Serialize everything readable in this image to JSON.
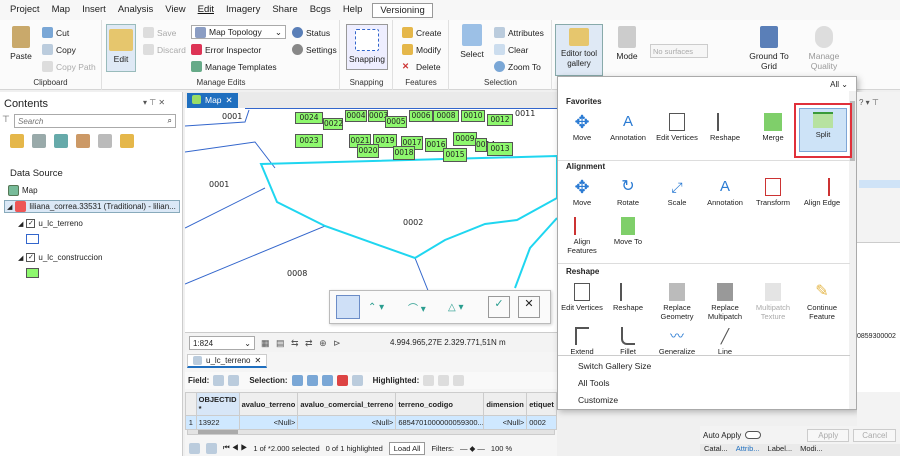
{
  "menu": [
    "Project",
    "Map",
    "Insert",
    "Analysis",
    "View",
    "Edit",
    "Imagery",
    "Share",
    "Bcgs",
    "Help",
    "Versioning"
  ],
  "ribbon": {
    "clipboard": {
      "paste": "Paste",
      "cut": "Cut",
      "copy": "Copy",
      "copy_path": "Copy Path",
      "label": "Clipboard"
    },
    "manage": {
      "edit": "Edit",
      "save": "Save",
      "discard": "Discard",
      "topology": "Map Topology",
      "error_inspector": "Error Inspector",
      "manage_templates": "Manage Templates",
      "status": "Status",
      "settings": "Settings",
      "label": "Manage Edits"
    },
    "snapping": {
      "snapping": "Snapping",
      "label": "Snapping"
    },
    "features": {
      "create": "Create",
      "modify": "Modify",
      "delete": "Delete",
      "label": "Features"
    },
    "selection": {
      "select": "Select",
      "attributes": "Attributes",
      "clear": "Clear",
      "zoom_to": "Zoom To",
      "label": "Selection"
    },
    "tools": {
      "gallery": "Editor tool gallery",
      "mode": "Mode",
      "no_surfaces": "No surfaces",
      "ground": "Ground To Grid",
      "quality": "Manage Quality"
    }
  },
  "contents": {
    "title": "Contents",
    "search_placeholder": "Search",
    "data_source": "Data Source",
    "map": "Map",
    "layer_main": "liliana_correa.33531 (Traditional) - lilian...",
    "layer1": "u_lc_terreno",
    "layer2": "u_lc_construccion"
  },
  "map": {
    "tab": "Map",
    "scale": "1:824",
    "coords": "4.994.965,27E 2.329.771,51N m",
    "labels_top": [
      "0024",
      "0022",
      "0004",
      "0003",
      "0005",
      "0006",
      "0008",
      "0010",
      "0012",
      "0023",
      "0021",
      "0019",
      "0017",
      "0016",
      "0009",
      "0014",
      "0013",
      "0020",
      "0018",
      "0015",
      "0011"
    ],
    "labels_big": [
      "0001",
      "0001",
      "0002",
      "0008"
    ]
  },
  "attributes": {
    "tab": "u_lc_terreno",
    "field": "Field:",
    "selection": "Selection:",
    "highlighted": "Highlighted:",
    "columns": [
      "OBJECTID *",
      "avaluo_terreno",
      "avaluo_comercial_terreno",
      "terreno_codigo",
      "dimension",
      "etiquet"
    ],
    "row": [
      "13922",
      "<Null>",
      "<Null>",
      "6854701000000059300...",
      "<Null>",
      "0002"
    ],
    "row_num": "1",
    "footer": {
      "selected": "1 of *2.000 selected",
      "highlighted": "0 of 1 highlighted",
      "load": "Load All",
      "filters": "Filters:",
      "zoom": "100 %"
    }
  },
  "gallery": {
    "all": "All",
    "favorites": {
      "title": "Favorites",
      "items": [
        "Move",
        "Annotation",
        "Edit Vertices",
        "Reshape",
        "Merge",
        "Split"
      ]
    },
    "alignment": {
      "title": "Alignment",
      "items": [
        "Move",
        "Rotate",
        "Scale",
        "Annotation",
        "Transform",
        "Align Edge",
        "Align Features",
        "Move To"
      ]
    },
    "reshape": {
      "title": "Reshape",
      "items": [
        "Edit Vertices",
        "Reshape",
        "Replace Geometry",
        "Replace Multipatch",
        "Multipatch Texture",
        "Continue Feature",
        "Extend",
        "Fillet",
        "Generalize",
        "Line"
      ]
    },
    "menu": [
      "Switch Gallery Size",
      "All Tools",
      "Customize"
    ]
  },
  "right": {
    "auto_apply": "Auto Apply",
    "apply": "Apply",
    "cancel": "Cancel",
    "value": "0859300002",
    "tabs": [
      "Catal...",
      "Attrib...",
      "Label...",
      "Modi..."
    ]
  }
}
